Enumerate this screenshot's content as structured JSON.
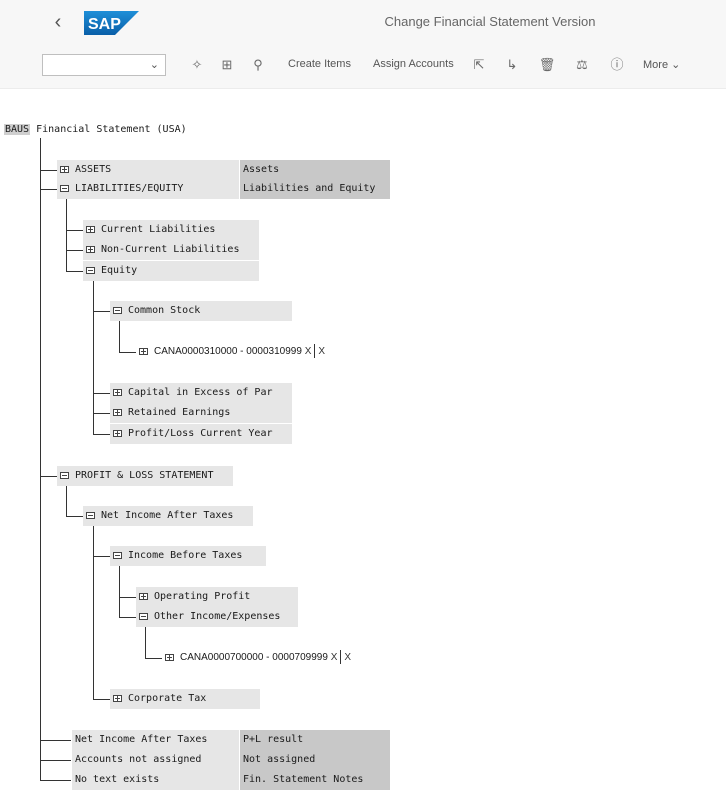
{
  "header": {
    "title": "Change Financial Statement Version",
    "back_icon": "chevron-left-icon",
    "logo_text": "SAP"
  },
  "toolbar": {
    "select_value": "",
    "create_items": "Create Items",
    "assign_accounts": "Assign Accounts",
    "more": "More"
  },
  "tree": {
    "root_code": "BAUS",
    "root_label": "Financial Statement (USA)",
    "assets": "ASSETS",
    "assets_desc": "Assets",
    "liab_equity": "LIABILITIES/EQUITY",
    "liab_equity_desc": "Liabilities and Equity",
    "current_liab": "Current Liabilities",
    "noncurrent_liab": "Non-Current Liabilities",
    "equity": "Equity",
    "common_stock": "Common Stock",
    "cs_accounts": "CANA0000310000 - 0000310999",
    "cs_flags1": "X",
    "cs_flags2": "X",
    "capital_excess": "Capital in Excess of Par",
    "retained_earnings": "Retained Earnings",
    "profit_loss_current": "Profit/Loss Current Year",
    "pl_statement": "PROFIT & LOSS STATEMENT",
    "net_income_after_taxes": "Net Income After Taxes",
    "income_before_taxes": "Income Before Taxes",
    "operating_profit": "Operating Profit",
    "other_income": "Other Income/Expenses",
    "oi_accounts": "CANA0000700000 - 0000709999",
    "oi_flags1": "X",
    "oi_flags2": "X",
    "corporate_tax": "Corporate Tax",
    "bottom_net_income": "Net Income After Taxes",
    "bottom_net_income_desc": "P+L result",
    "accounts_not_assigned": "Accounts not assigned",
    "accounts_not_assigned_desc": "Not assigned",
    "no_text_exists": "No text exists",
    "no_text_exists_desc": "Fin. Statement Notes"
  }
}
